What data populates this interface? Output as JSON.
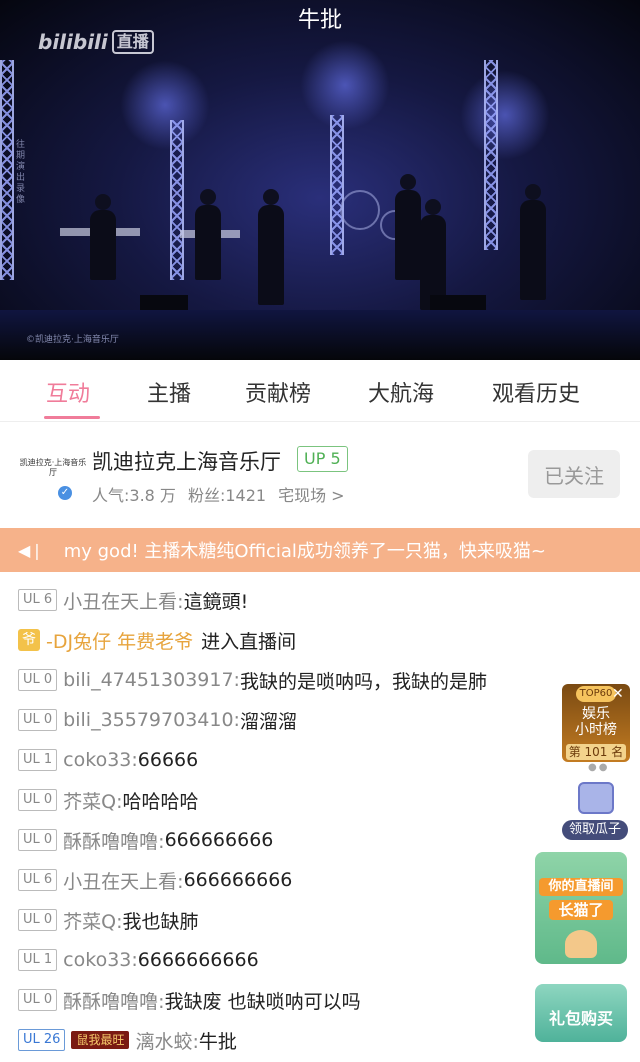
{
  "video": {
    "title": "牛批",
    "logo_text": "bilibili",
    "logo_live": "直播",
    "vertical_note": "往期演出录像",
    "copyright": "©凯迪拉克·上海音乐厅"
  },
  "tabs": [
    {
      "label": "互动",
      "active": true
    },
    {
      "label": "主播",
      "active": false
    },
    {
      "label": "贡献榜",
      "active": false
    },
    {
      "label": "大航海",
      "active": false
    },
    {
      "label": "观看历史",
      "active": false
    }
  ],
  "anchor": {
    "name": "凯迪拉克上海音乐厅",
    "up_badge": "UP 5",
    "popularity": "人气:3.8 万",
    "fans": "粉丝:1421",
    "category": "宅现场 >",
    "follow_label": "已关注",
    "avatar_text": "凯迪拉克·上海音乐厅"
  },
  "notice": {
    "text": "my god! 主播木糖纯Official成功领养了一只猫，快来吸猫~"
  },
  "chat": [
    {
      "level": "UL 6",
      "user": "小丑在天上看:",
      "message": "這鏡頭!"
    },
    {
      "vip_icon": "爷",
      "user": "-DJ兔仔 年费老爷",
      "message": "进入直播间"
    },
    {
      "level": "UL 0",
      "user": "bili_47451303917:",
      "message": "我缺的是唢呐吗，我缺的是肺"
    },
    {
      "level": "UL 0",
      "user": "bili_35579703410:",
      "message": "溜溜溜"
    },
    {
      "level": "UL 1",
      "user": "coko33:",
      "message": "66666"
    },
    {
      "level": "UL 0",
      "user": "芥菜Q:",
      "message": "哈哈哈哈"
    },
    {
      "level": "UL 0",
      "user": "酥酥噜噜噜:",
      "message": "666666666"
    },
    {
      "level": "UL 6",
      "user": "小丑在天上看:",
      "message": "666666666"
    },
    {
      "level": "UL 0",
      "user": "芥菜Q:",
      "message": "我也缺肺"
    },
    {
      "level": "UL 1",
      "user": "coko33:",
      "message": "6666666666"
    },
    {
      "level": "UL 0",
      "user": "酥酥噜噜噜:",
      "message": "我缺废 也缺唢呐可以吗"
    },
    {
      "level": "UL 26",
      "medal": "鼠我最旺",
      "user": "漓水蛟:",
      "message": "牛批"
    }
  ],
  "side": {
    "rank_badge": "TOP60",
    "rank_line1": "娱乐",
    "rank_line2": "小时榜",
    "rank_position": "第 101 名",
    "melon_label": "领取瓜子",
    "cat_ad_line1": "你的直播间",
    "cat_ad_line2": "长猫了",
    "gift_ad": "礼包购买"
  },
  "colors": {
    "accent_pink": "#f07c9a",
    "notice_bg": "#f6b28a",
    "up_green": "#4fb054",
    "vip_gold": "#e7a43d"
  }
}
